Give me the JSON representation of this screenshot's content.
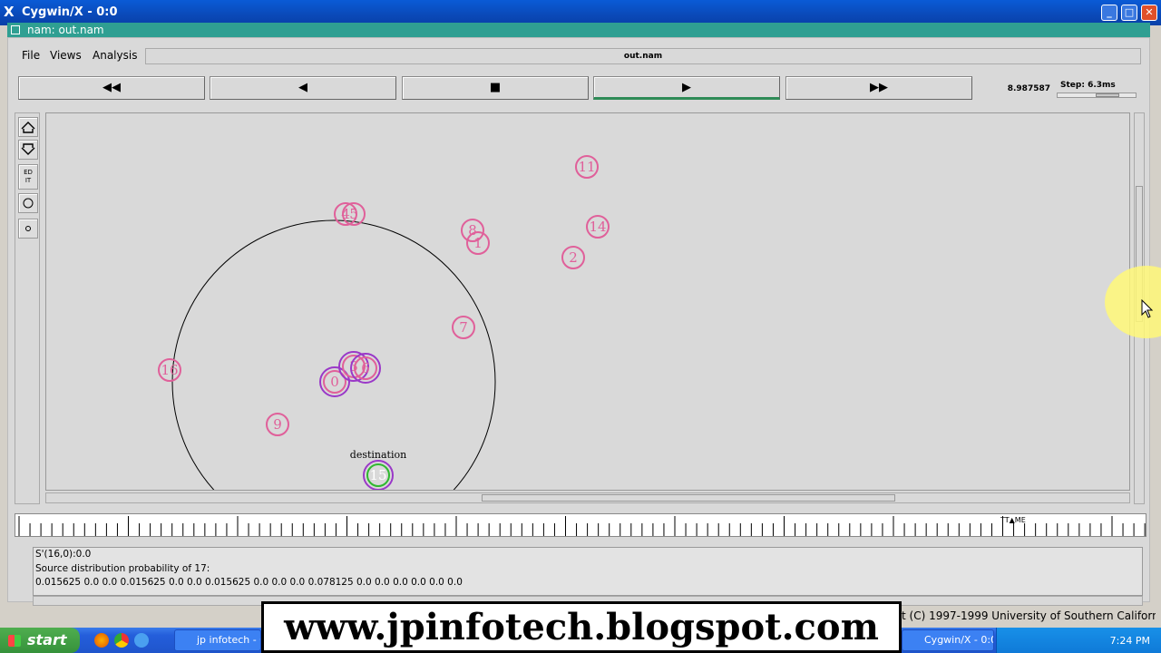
{
  "window": {
    "title": "Cygwin/X - 0:0",
    "inner_title": "nam: out.nam"
  },
  "menu": {
    "file": "File",
    "views": "Views",
    "analysis": "Analysis"
  },
  "filename": "out.nam",
  "controls": {
    "rewind": "◀◀",
    "back": "◀",
    "stop": "■",
    "play": "▶",
    "fastforward": "▶▶"
  },
  "time_value": "8.987587",
  "step_label": "Step: 6.3ms",
  "tools": {
    "edit": "ED\nIT"
  },
  "network": {
    "range_circle": {},
    "nodes": [
      {
        "id": "11",
        "color": "#e0609a"
      },
      {
        "id": "4",
        "color": "#e0609a"
      },
      {
        "id": "5",
        "color": "#e0609a"
      },
      {
        "id": "8",
        "color": "#e0609a"
      },
      {
        "id": "1",
        "color": "#e0609a"
      },
      {
        "id": "14",
        "color": "#e0609a"
      },
      {
        "id": "2",
        "color": "#e0609a"
      },
      {
        "id": "7",
        "color": "#e0609a"
      },
      {
        "id": "16",
        "color": "#e0609a"
      },
      {
        "id": "9",
        "color": "#e0609a"
      },
      {
        "id": "0",
        "color": "#e0609a",
        "ring": "#9a38c8"
      },
      {
        "id": "3",
        "color": "#e0609a",
        "ring": "#9a38c8"
      },
      {
        "id": "6",
        "color": "#e0609a",
        "ring": "#9a38c8"
      },
      {
        "id": "15",
        "color": "#2fb82f",
        "ring": "#9a38c8",
        "fill": "#7cf07c"
      }
    ],
    "destination_label": "destination"
  },
  "info": {
    "line1": "S'(16,0):0.0",
    "line2": "Source distribution probability of 17:",
    "line3": "0.015625 0.0 0.0 0.015625 0.0 0.0 0.015625 0.0 0.0 0.0 0.078125 0.0 0.0 0.0 0.0 0.0 0.0"
  },
  "copyright": "t (C) 1997-1999 University of Southern California",
  "taskbar": {
    "start": "start",
    "item1": "jp infotech - Goo",
    "item2": "Cygwin/X - 0:0",
    "clock": "7:24 PM"
  },
  "banner": "www.jpinfotech.blogspot.com",
  "timeline_marker": "TT▲ME"
}
